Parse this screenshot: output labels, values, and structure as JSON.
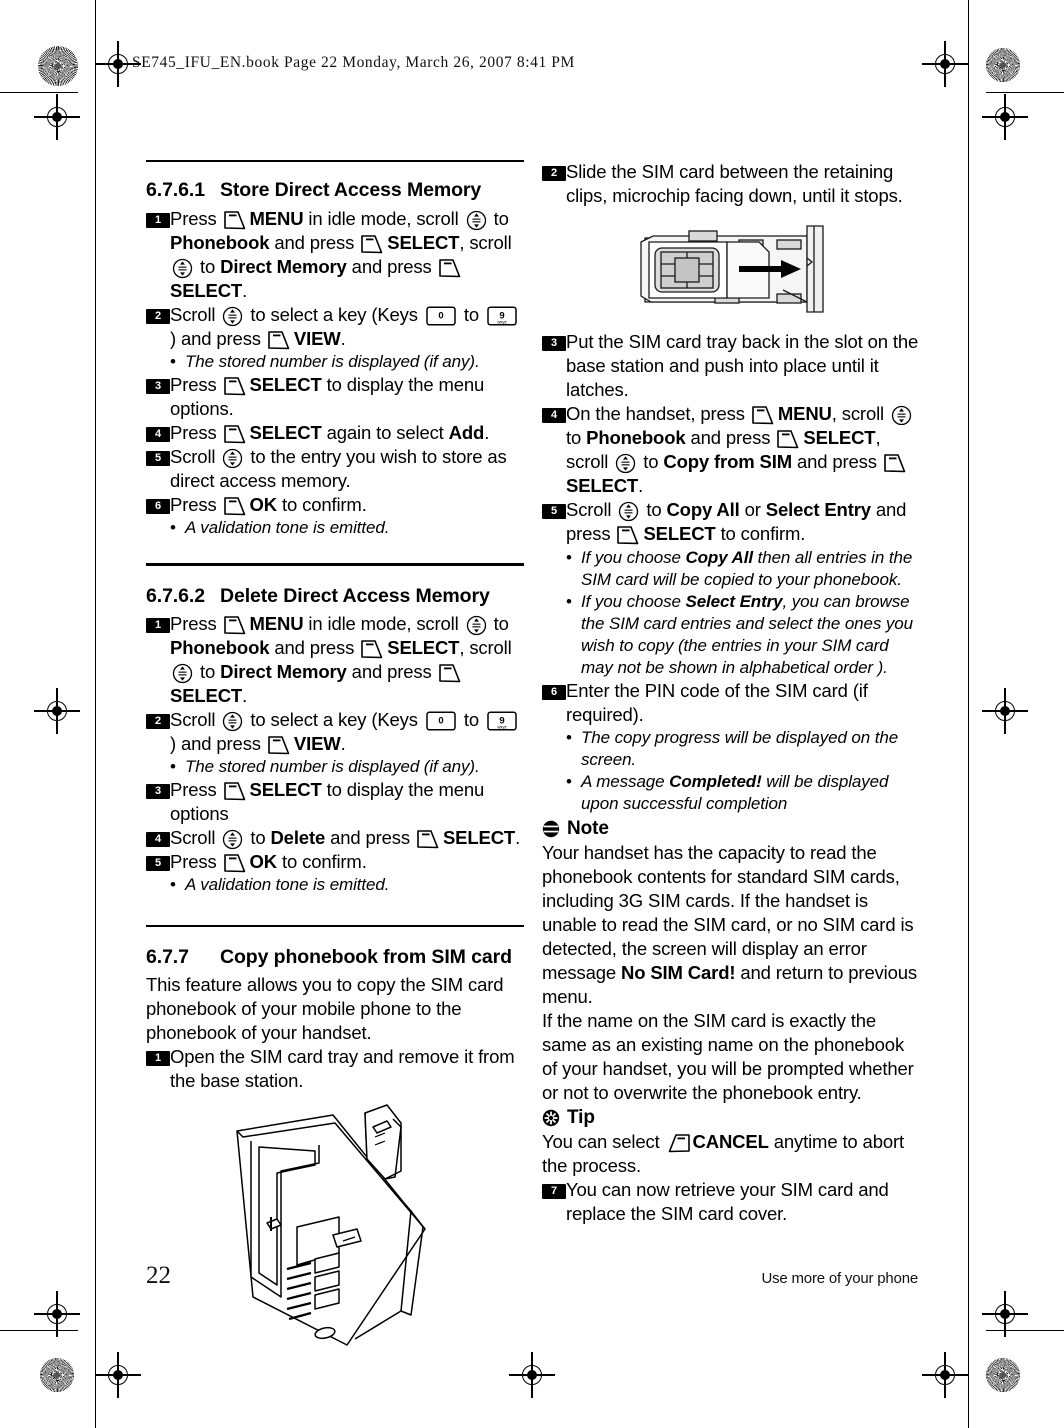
{
  "header": {
    "slug": "SE745_IFU_EN.book  Page 22  Monday, March 26, 2007  8:41 PM"
  },
  "footer": {
    "page_number": "22",
    "running_foot": "Use more of your phone"
  },
  "icons": {
    "softkey_left": "left-softkey-icon",
    "softkey_right": "right-softkey-icon",
    "scroll": "scroll-up-down-icon",
    "key_0": "0",
    "key_9": "9",
    "key_9_letters": "wxyz",
    "note": "note-icon",
    "tip": "tip-icon",
    "sim_tray_figure": "sim-card-tray-illustration",
    "base_station_figure": "base-station-illustration"
  },
  "left_column": {
    "section_6761": {
      "number": "6.7.6.1",
      "title": "Store Direct Access Memory",
      "steps": [
        {
          "n": "1",
          "parts": [
            {
              "t": "Press ",
              "s": "plain"
            },
            {
              "t": "softkey",
              "s": "icon"
            },
            {
              "t": "MENU",
              "s": "bold"
            },
            {
              "t": " in idle mode, scroll ",
              "s": "plain"
            },
            {
              "t": "scroll",
              "s": "icon"
            },
            {
              "t": " to ",
              "s": "plain"
            },
            {
              "t": "Phonebook",
              "s": "bold"
            },
            {
              "t": " and press ",
              "s": "plain"
            },
            {
              "t": "softkey",
              "s": "icon"
            },
            {
              "t": "SELECT",
              "s": "bold"
            },
            {
              "t": ", scroll ",
              "s": "plain"
            },
            {
              "t": "scroll",
              "s": "icon"
            },
            {
              "t": " to ",
              "s": "plain"
            },
            {
              "t": "Direct Memory",
              "s": "bold"
            },
            {
              "t": " and press ",
              "s": "plain"
            },
            {
              "t": "softkey",
              "s": "icon"
            },
            {
              "t": "SELECT",
              "s": "bold"
            },
            {
              "t": ".",
              "s": "plain"
            }
          ]
        },
        {
          "n": "2",
          "parts": [
            {
              "t": "Scroll ",
              "s": "plain"
            },
            {
              "t": "scroll",
              "s": "icon"
            },
            {
              "t": " to select a key (Keys ",
              "s": "plain"
            },
            {
              "t": "key0",
              "s": "icon"
            },
            {
              "t": " to ",
              "s": "plain"
            },
            {
              "t": "key9",
              "s": "icon"
            },
            {
              "t": ") and press ",
              "s": "plain"
            },
            {
              "t": "softkey",
              "s": "icon"
            },
            {
              "t": "VIEW",
              "s": "bold"
            },
            {
              "t": ".",
              "s": "plain"
            }
          ]
        },
        {
          "n": "3",
          "parts": [
            {
              "t": "Press ",
              "s": "plain"
            },
            {
              "t": "softkey",
              "s": "icon"
            },
            {
              "t": "SELECT",
              "s": "bold"
            },
            {
              "t": " to display the menu options.",
              "s": "plain"
            }
          ]
        },
        {
          "n": "4",
          "parts": [
            {
              "t": "Press ",
              "s": "plain"
            },
            {
              "t": "softkey",
              "s": "icon"
            },
            {
              "t": "SELECT",
              "s": "bold"
            },
            {
              "t": " again to select ",
              "s": "plain"
            },
            {
              "t": "Add",
              "s": "bold"
            },
            {
              "t": ".",
              "s": "plain"
            }
          ]
        },
        {
          "n": "5",
          "parts": [
            {
              "t": "Scroll ",
              "s": "plain"
            },
            {
              "t": "scroll",
              "s": "icon"
            },
            {
              "t": " to the entry you wish to store as direct access memory.",
              "s": "plain"
            }
          ]
        },
        {
          "n": "6",
          "parts": [
            {
              "t": "Press ",
              "s": "plain"
            },
            {
              "t": "softkey",
              "s": "icon"
            },
            {
              "t": "OK",
              "s": "bold"
            },
            {
              "t": " to confirm.",
              "s": "plain"
            }
          ]
        }
      ],
      "bullets": [
        "The stored number is displayed (if any).",
        "A validation tone is emitted."
      ]
    },
    "section_6762": {
      "number": "6.7.6.2",
      "title": "Delete Direct Access Memory",
      "bullets": [
        "The stored number is displayed (if any).",
        "A validation tone is emitted."
      ]
    },
    "section_677": {
      "number": "6.7.7",
      "title_plain_1": "Copy phonebook from ",
      "title_bold": "SIM",
      "title_plain_2": " card",
      "intro": "This feature allows you to copy the SIM card phonebook of your mobile phone to the phonebook of your handset.",
      "step1_num": "1",
      "step1_text": "Open the SIM card tray and remove it from the base station."
    }
  },
  "right_column": {
    "step2_num": "2",
    "step2_text": "Slide the SIM card between the retaining clips, microchip facing down, until it stops.",
    "step3_num": "3",
    "step3_text": "Put the SIM card tray back in the slot on the base station and push into place until it latches.",
    "step4_num": "4",
    "step5_num": "5",
    "step5_bullets": [
      "If you choose Copy All then all entries in the SIM card will be copied to your phonebook.",
      "If you choose Select Entry, you can browse the SIM card entries and select the ones you wish to copy (the entries in your SIM card may not be shown in alphabetical order )."
    ],
    "step6_num": "6",
    "step6_text": "Enter the PIN code of the SIM card (if required).",
    "step6_bullets": [
      "The copy progress will be displayed on the screen.",
      "A message Completed! will be displayed upon successful completion"
    ],
    "note_label": "Note",
    "note_para_1_a": "Your handset has the capacity to read the phonebook contents for standard SIM cards, including 3G SIM cards. If the handset is unable to read the SIM card, or no SIM card is detected, the screen will display an error message ",
    "note_para_1_b": "No SIM Card!",
    "note_para_1_c": " and return to previous menu.",
    "note_para_2": "If the name on the SIM card is exactly the same as an existing name on the phonebook of your handset, you will be prompted whether or not to overwrite the phonebook entry.",
    "tip_label": "Tip",
    "tip_text_a": "You can select ",
    "tip_text_b": "CANCEL",
    "tip_text_c": " anytime to abort the process.",
    "step7_num": "7",
    "step7_text": "You can now retrieve your SIM card and replace the SIM card cover."
  }
}
